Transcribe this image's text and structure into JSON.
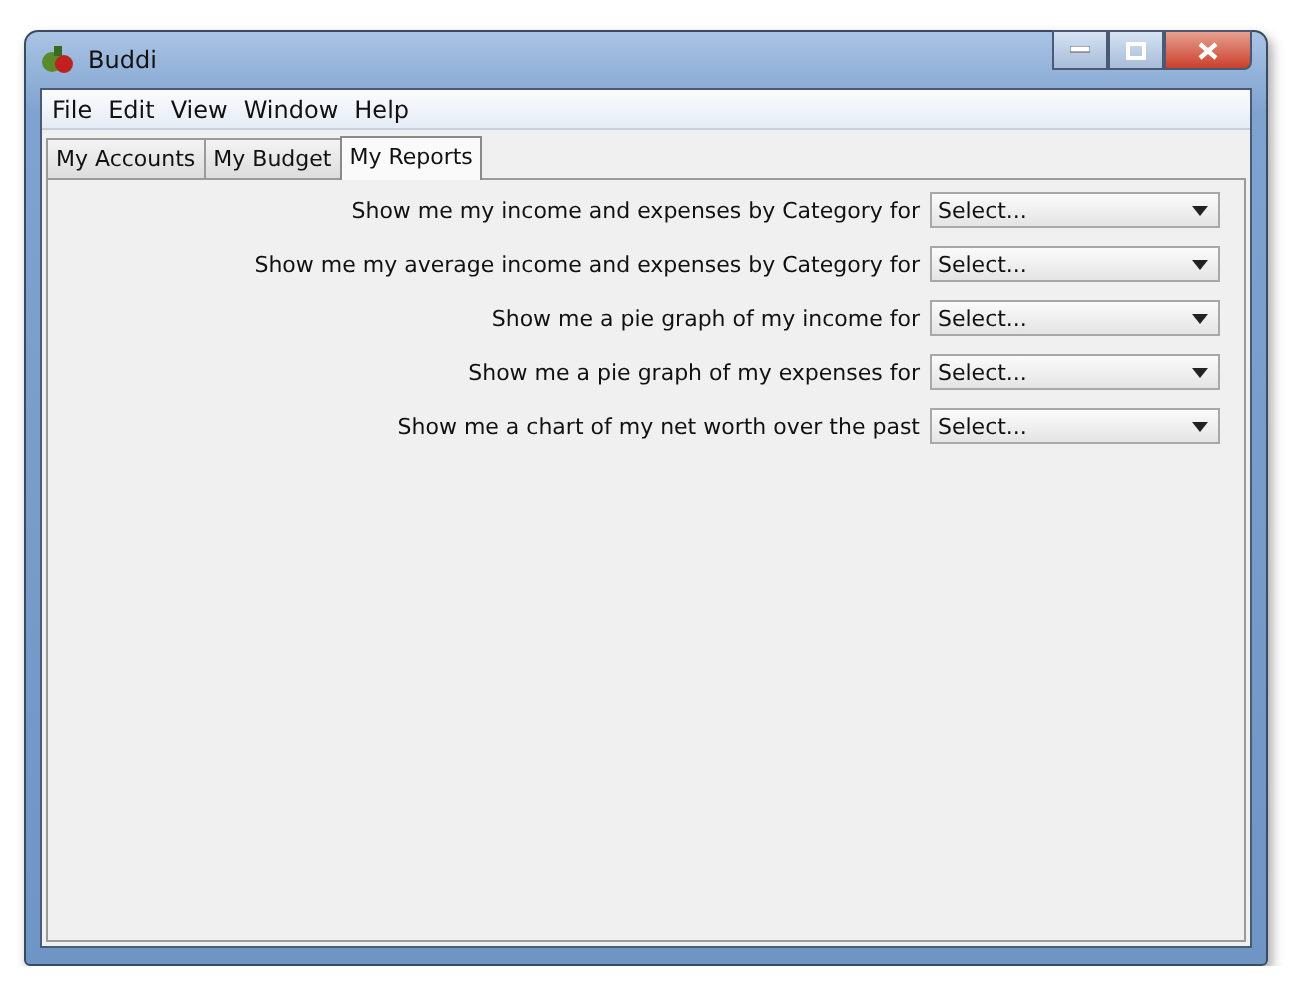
{
  "window": {
    "title": "Buddi"
  },
  "menu": [
    "File",
    "Edit",
    "View",
    "Window",
    "Help"
  ],
  "tabs": [
    {
      "label": "My Accounts",
      "selected": false
    },
    {
      "label": "My Budget",
      "selected": false
    },
    {
      "label": "My Reports",
      "selected": true
    }
  ],
  "reports": [
    {
      "label": "Show me my income and expenses by Category for",
      "value": "Select..."
    },
    {
      "label": "Show me my average income and expenses by Category for",
      "value": "Select..."
    },
    {
      "label": "Show me a pie graph of my income for",
      "value": "Select..."
    },
    {
      "label": "Show me a pie graph of my expenses for",
      "value": "Select..."
    },
    {
      "label": "Show me a chart of my net worth over the past",
      "value": "Select..."
    }
  ]
}
